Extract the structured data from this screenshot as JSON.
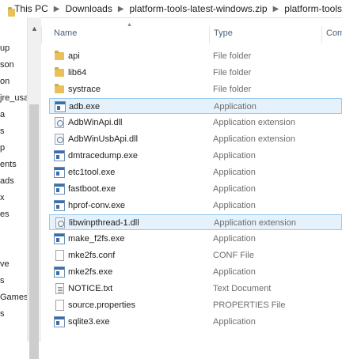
{
  "address": {
    "crumbs": [
      "This PC",
      "Downloads",
      "platform-tools-latest-windows.zip",
      "platform-tools"
    ]
  },
  "nav": {
    "items": [
      "up",
      "son",
      "on",
      "jre_usag",
      "a",
      "s",
      "p",
      "ents",
      "ads",
      "x",
      "es",
      "ve",
      "s",
      "Games",
      "s"
    ]
  },
  "columns": {
    "name": "Name",
    "type": "Type",
    "comment": "Com"
  },
  "files": [
    {
      "name": "api",
      "type": "File folder",
      "icon": "folder-icon"
    },
    {
      "name": "lib64",
      "type": "File folder",
      "icon": "folder-icon"
    },
    {
      "name": "systrace",
      "type": "File folder",
      "icon": "folder-icon"
    },
    {
      "name": "adb.exe",
      "type": "Application",
      "icon": "application-icon",
      "selected": true
    },
    {
      "name": "AdbWinApi.dll",
      "type": "Application extension",
      "icon": "dll-icon"
    },
    {
      "name": "AdbWinUsbApi.dll",
      "type": "Application extension",
      "icon": "dll-icon"
    },
    {
      "name": "dmtracedump.exe",
      "type": "Application",
      "icon": "application-icon"
    },
    {
      "name": "etc1tool.exe",
      "type": "Application",
      "icon": "application-icon"
    },
    {
      "name": "fastboot.exe",
      "type": "Application",
      "icon": "application-icon"
    },
    {
      "name": "hprof-conv.exe",
      "type": "Application",
      "icon": "application-icon"
    },
    {
      "name": "libwinpthread-1.dll",
      "type": "Application extension",
      "icon": "dll-icon",
      "selected": true
    },
    {
      "name": "make_f2fs.exe",
      "type": "Application",
      "icon": "application-icon"
    },
    {
      "name": "mke2fs.conf",
      "type": "CONF File",
      "icon": "document-icon"
    },
    {
      "name": "mke2fs.exe",
      "type": "Application",
      "icon": "application-icon"
    },
    {
      "name": "NOTICE.txt",
      "type": "Text Document",
      "icon": "text-document-icon"
    },
    {
      "name": "source.properties",
      "type": "PROPERTIES File",
      "icon": "document-icon"
    },
    {
      "name": "sqlite3.exe",
      "type": "Application",
      "icon": "application-icon"
    }
  ]
}
